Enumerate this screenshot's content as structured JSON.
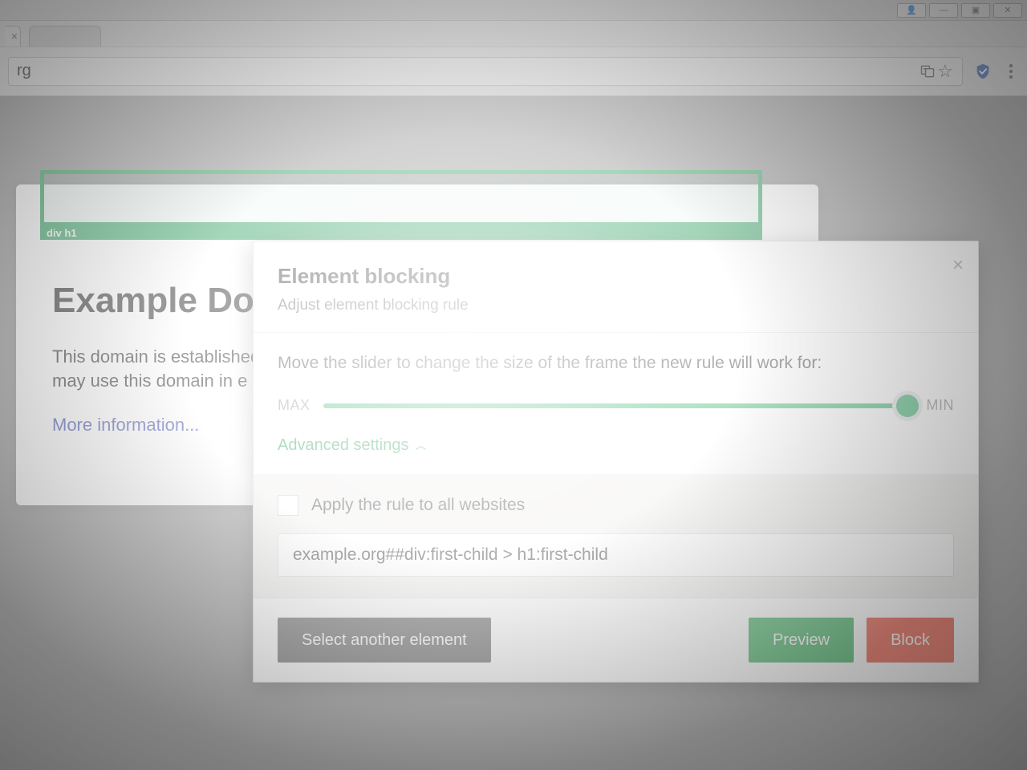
{
  "browser": {
    "url_fragment": "rg",
    "window_controls": {
      "user": "👤",
      "min": "—",
      "max": "▣",
      "close": "✕"
    },
    "tab_close": "×",
    "toolbar_icons": {
      "translate": "⎙",
      "star": "☆",
      "shield": "shield",
      "menu": "⋮"
    }
  },
  "page": {
    "heading": "Example Domain",
    "paragraph1": "This domain is established",
    "paragraph2": "may use this domain in e",
    "link": "More information..."
  },
  "highlight": {
    "selector_label": "div h1"
  },
  "modal": {
    "title": "Element blocking",
    "subtitle": "Adjust element blocking rule",
    "instructions": "Move the slider to change the size of the frame the new rule will work for:",
    "slider": {
      "left_label": "MAX",
      "right_label": "MIN",
      "position": 100
    },
    "advanced_toggle": "Advanced settings",
    "apply_all_label": "Apply the rule to all websites",
    "apply_all_checked": false,
    "rule_value": "example.org##div:first-child > h1:first-child",
    "buttons": {
      "select_another": "Select another element",
      "preview": "Preview",
      "block": "Block"
    },
    "close": "×"
  }
}
